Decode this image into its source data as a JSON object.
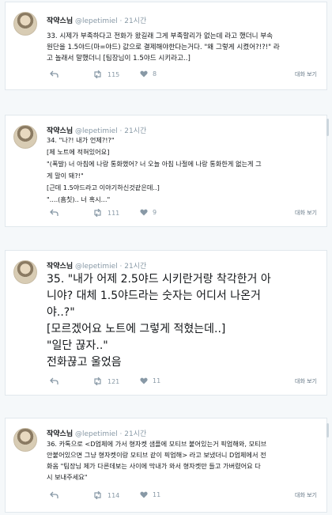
{
  "tweets": [
    {
      "name": "작약스님",
      "handle": "@lepetimiel",
      "time": "· 21시간",
      "lines": [
        "33. 시제가 부족하다고 전화가 왔길래 그게 부족할리가 없는데 라고 했더니 부속",
        "원단을 1.5야드(마=야드) 값으로 결제해야한다는거다. \"왜 그렇게 시켰어?!?!\" 라",
        "고 놀래서 말했더니 [팀장님이 1.5야드 시키라고..]"
      ],
      "retweets": "115",
      "likes": "8",
      "conversation": "대화 보기"
    },
    {
      "name": "작약스님",
      "handle": "@lepetimiel",
      "time": "· 21시간",
      "lines": [
        "34. \"나?! 내가 언제?!?\"",
        "[제 노트에 적혀있어요]",
        "\"(폭발) 너 아침에 나랑 통화했어? 너 오늘 아침 나절에 나랑 통화한게 없는게 그",
        "게 말이 돼?!\"",
        "[근데 1.5야드라고 이야기하신것같은데..]",
        "\"....(흠칫).. 너 혹시...\""
      ],
      "retweets": "111",
      "likes": "9",
      "conversation": "대화 보기"
    },
    {
      "name": "작약스님",
      "handle": "@lepetimiel",
      "time": "· 21시간",
      "lines": [
        "35. \"내가 어제 2.5야드 시키란거랑 착각한거 아",
        "니야? 대체 1.5야드라는 숫자는 어디서 나온거",
        "야..?\"",
        "[모르겠어요 노트에 그렇게 적혔는데..]",
        "\"일단 끊자..\"",
        "전화끊고 울었음"
      ],
      "retweets": "121",
      "likes": "11",
      "conversation": "대화 보기"
    },
    {
      "name": "작약스님",
      "handle": "@lepetimiel",
      "time": "· 21시간",
      "lines": [
        "36. 카톡으로 <D업체에 가서 형자켓 샘플에 모티브 붙어있는거 픽업해와, 모티브",
        "안붙어있으면 그냥 형자켓이랑 모티브 같이 픽업해> 라고 보냈더니 D업체에서 전",
        "화옴 \"팀장님 제가 다른데보는 사이에 막내가 와서 형자켓만 들고 가버렸어요 다",
        "시 보내주세요\""
      ],
      "retweets": "114",
      "likes": "11",
      "conversation": "대화 보기"
    }
  ]
}
